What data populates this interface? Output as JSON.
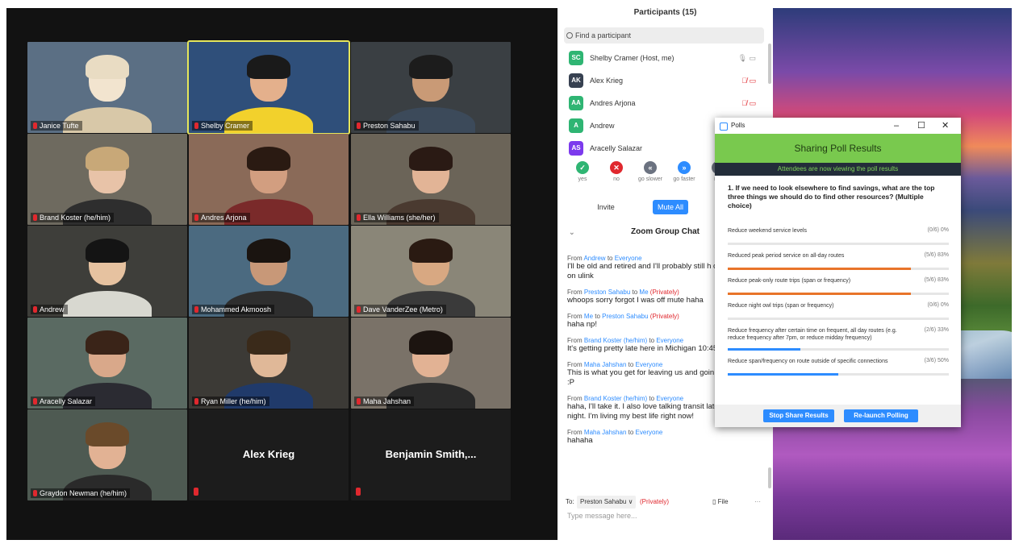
{
  "participants_panel": {
    "title": "Participants (15)",
    "search_placeholder": "Find a participant",
    "list": [
      {
        "initials": "SC",
        "name": "Shelby Cramer (Host, me)",
        "color": "#2fb573",
        "muted": false
      },
      {
        "initials": "AK",
        "name": "Alex Krieg",
        "color": "#374151",
        "muted": true
      },
      {
        "initials": "AA",
        "name": "Andres Arjona",
        "color": "#2fb573",
        "muted": true
      },
      {
        "initials": "A",
        "name": "Andrew",
        "color": "#2fb573",
        "muted": false
      },
      {
        "initials": "AS",
        "name": "Aracelly Salazar",
        "color": "#7c3aed",
        "muted": false
      }
    ],
    "reactions": [
      {
        "label": "yes",
        "symbol": "✓",
        "color": "#2fb573"
      },
      {
        "label": "no",
        "symbol": "✕",
        "color": "#e0282e"
      },
      {
        "label": "go slower",
        "symbol": "«",
        "color": "#6b7280"
      },
      {
        "label": "go faster",
        "symbol": "»",
        "color": "#2d8cff"
      },
      {
        "label": "mo",
        "symbol": "…",
        "color": "#6b7280"
      }
    ],
    "invite_label": "Invite",
    "mute_all_label": "Mute All"
  },
  "chat": {
    "title": "Zoom Group Chat",
    "messages": [
      {
        "prefix": "From",
        "sender": "Andrew",
        "mid": "to",
        "recipient": "Everyone",
        "private": "",
        "text": "I'll be old and retired and I'll probably still h comments on ulink"
      },
      {
        "prefix": "From",
        "sender": "Preston Sahabu",
        "mid": "to",
        "recipient": "Me",
        "private": "(Privately)",
        "text": "whoops sorry forgot I was off mute haha"
      },
      {
        "prefix": "From",
        "sender": "Me",
        "mid": "to",
        "recipient": "Preston Sahabu",
        "private": "(Privately)",
        "text": "haha np!"
      },
      {
        "prefix": "From",
        "sender": "Brand Koster (he/him)",
        "mid": "to",
        "recipient": "Everyone",
        "private": "",
        "text": "It's getting pretty late here in Michigan 10:45pm"
      },
      {
        "prefix": "From",
        "sender": "Maha Jahshan",
        "mid": "to",
        "recipient": "Everyone",
        "private": "",
        "text": "This is what you get for leaving us and goin Michigan :P"
      },
      {
        "prefix": "From",
        "sender": "Brand Koster (he/him)",
        "mid": "to",
        "recipient": "Everyone",
        "private": "",
        "text": "haha, I'll take it. I also love talking transit late into the night. I'm living my best life right now!"
      },
      {
        "prefix": "From",
        "sender": "Maha Jahshan",
        "mid": "to",
        "recipient": "Everyone",
        "private": "",
        "text": "hahaha"
      }
    ],
    "to_label": "To:",
    "to_value": "Preston Sahabu ∨",
    "to_private": "(Privately)",
    "file_label": "File",
    "more_label": "···",
    "input_placeholder": "Type message here..."
  },
  "video_tiles": [
    {
      "name": "Janice Tufte",
      "bg": "#5b6f84",
      "skin": "#f2e4cf",
      "shirt": "#d8c8a8",
      "hair": "#e9dcc3",
      "active": false
    },
    {
      "name": "Shelby Cramer",
      "bg": "#2f4f7a",
      "skin": "#e4b08c",
      "shirt": "#f2d12c",
      "hair": "#1a1a1a",
      "active": true
    },
    {
      "name": "Preston Sahabu",
      "bg": "#3a3f43",
      "skin": "#c99a76",
      "shirt": "#3c4a5a",
      "hair": "#1c1c1c",
      "active": false
    },
    {
      "name": "Brand Koster (he/him)",
      "bg": "#6e6a5f",
      "skin": "#e8c3a8",
      "shirt": "#2e2e2e",
      "hair": "#c8a878",
      "active": false
    },
    {
      "name": "Andres Arjona",
      "bg": "#8a6a58",
      "skin": "#d29e80",
      "shirt": "#7a2a2a",
      "hair": "#2a1a12",
      "active": false
    },
    {
      "name": "Ella Williams (she/her)",
      "bg": "#6b6458",
      "skin": "#e2b496",
      "shirt": "#4a3a30",
      "hair": "#2a1a14",
      "active": false
    },
    {
      "name": "Andrew",
      "bg": "#3e3e3a",
      "skin": "#e6c2a0",
      "shirt": "#d8d8d0",
      "hair": "#141414",
      "active": false
    },
    {
      "name": "Mohammed Akmoosh",
      "bg": "#4b6a80",
      "skin": "#c89878",
      "shirt": "#2e2e2e",
      "hair": "#1a1410",
      "active": false
    },
    {
      "name": "Dave VanderZee (Metro)",
      "bg": "#8a8678",
      "skin": "#d8a882",
      "shirt": "#3a3a3a",
      "hair": "#2a1a12",
      "active": false
    },
    {
      "name": "Aracelly Salazar",
      "bg": "#5a6a62",
      "skin": "#d9a88a",
      "shirt": "#2b2b32",
      "hair": "#3a2418",
      "active": false
    },
    {
      "name": "Ryan Miller (he/him)",
      "bg": "#3c3a36",
      "skin": "#e0b898",
      "shirt": "#203a6a",
      "hair": "#3a2a1a",
      "active": false
    },
    {
      "name": "Maha Jahshan",
      "bg": "#7a7268",
      "skin": "#e2b294",
      "shirt": "#2a2a2a",
      "hair": "#1c1410",
      "active": false
    },
    {
      "name": "Graydon Newman (he/him)",
      "bg": "#4e5a52",
      "skin": "#e2b294",
      "shirt": "#2a2a2a",
      "hair": "#6a4a2a",
      "active": false
    }
  ],
  "blank_tiles": [
    {
      "name": "Alex Krieg"
    },
    {
      "name": "Benjamin  Smith,..."
    }
  ],
  "polls_window": {
    "title": "Polls",
    "minimize": "–",
    "maximize": "☐",
    "close": "✕",
    "sharing_title": "Sharing Poll Results",
    "viewing_text": "Attendees are now viewing the poll results",
    "question": "1. If we need to look elsewhere to find savings, what are the top three things we should do to find other resources? (Multiple choice)",
    "options": [
      {
        "label": "Reduce weekend service levels",
        "result": "(0/6) 0%",
        "fraction": 0.0,
        "color": "#e8742a"
      },
      {
        "label": "Reduced peak period service on all-day routes",
        "result": "(5/6) 83%",
        "fraction": 0.83,
        "color": "#e8742a"
      },
      {
        "label": "Reduce peak-only route trips (span or frequency)",
        "result": "(5/6) 83%",
        "fraction": 0.83,
        "color": "#e8742a"
      },
      {
        "label": "Reduce night owl trips (span or frequency)",
        "result": "(0/6) 0%",
        "fraction": 0.0,
        "color": "#2d8cff"
      },
      {
        "label": "Reduce frequency after certain time on frequent, all day routes (e.g. reduce frequency after 7pm, or reduce midday frequency)",
        "result": "(2/6) 33%",
        "fraction": 0.33,
        "color": "#2d8cff"
      },
      {
        "label": "Reduce span/frequency on route outside of specific connections",
        "result": "(3/6) 50%",
        "fraction": 0.5,
        "color": "#2d8cff"
      }
    ],
    "stop_share_label": "Stop Share Results",
    "relaunch_label": "Re-launch Polling"
  }
}
